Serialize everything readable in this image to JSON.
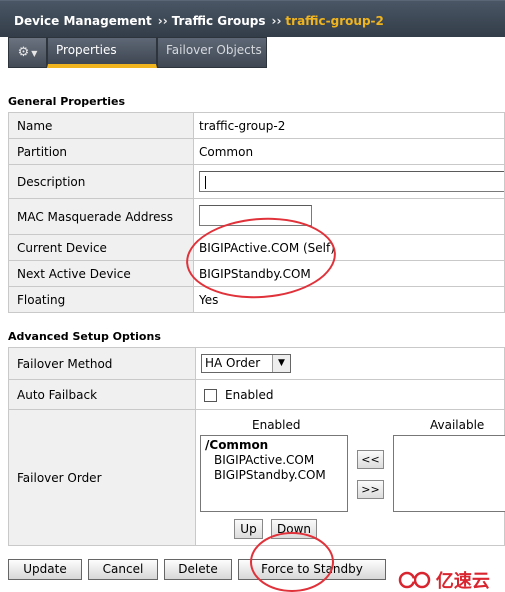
{
  "breadcrumb": {
    "root": "Device Management",
    "middle": "Traffic Groups",
    "current": "traffic-group-2",
    "separator": "››"
  },
  "tabs": {
    "gear_icon": "gear-icon",
    "active": "Properties",
    "inactive": "Failover Objects"
  },
  "general": {
    "heading": "General Properties",
    "rows": {
      "name": {
        "label": "Name",
        "value": "traffic-group-2"
      },
      "partition": {
        "label": "Partition",
        "value": "Common"
      },
      "description": {
        "label": "Description",
        "value": ""
      },
      "mac": {
        "label": "MAC Masquerade Address",
        "value": ""
      },
      "current_device": {
        "label": "Current Device",
        "value": "BIGIPActive.COM (Self)"
      },
      "next_active": {
        "label": "Next Active Device",
        "value": "BIGIPStandby.COM"
      },
      "floating": {
        "label": "Floating",
        "value": "Yes"
      }
    }
  },
  "advanced": {
    "heading": "Advanced Setup Options",
    "failover_method": {
      "label": "Failover Method",
      "selected": "HA Order"
    },
    "auto_failback": {
      "label": "Auto Failback",
      "checkbox_label": "Enabled",
      "checked": false
    },
    "failover_order": {
      "label": "Failover Order",
      "enabled_header": "Enabled",
      "available_header": "Available",
      "enabled_items": [
        "/Common",
        "BIGIPActive.COM",
        "BIGIPStandby.COM"
      ],
      "available_items": [],
      "move_left": "<<",
      "move_right": ">>",
      "up": "Up",
      "down": "Down"
    }
  },
  "buttons": {
    "update": "Update",
    "cancel": "Cancel",
    "delete": "Delete",
    "force_standby": "Force to Standby"
  },
  "watermark": {
    "text": "亿速云"
  },
  "colors": {
    "accent": "#f0b41e",
    "header_bg": "#3b4552",
    "annotation": "#e0323a"
  }
}
